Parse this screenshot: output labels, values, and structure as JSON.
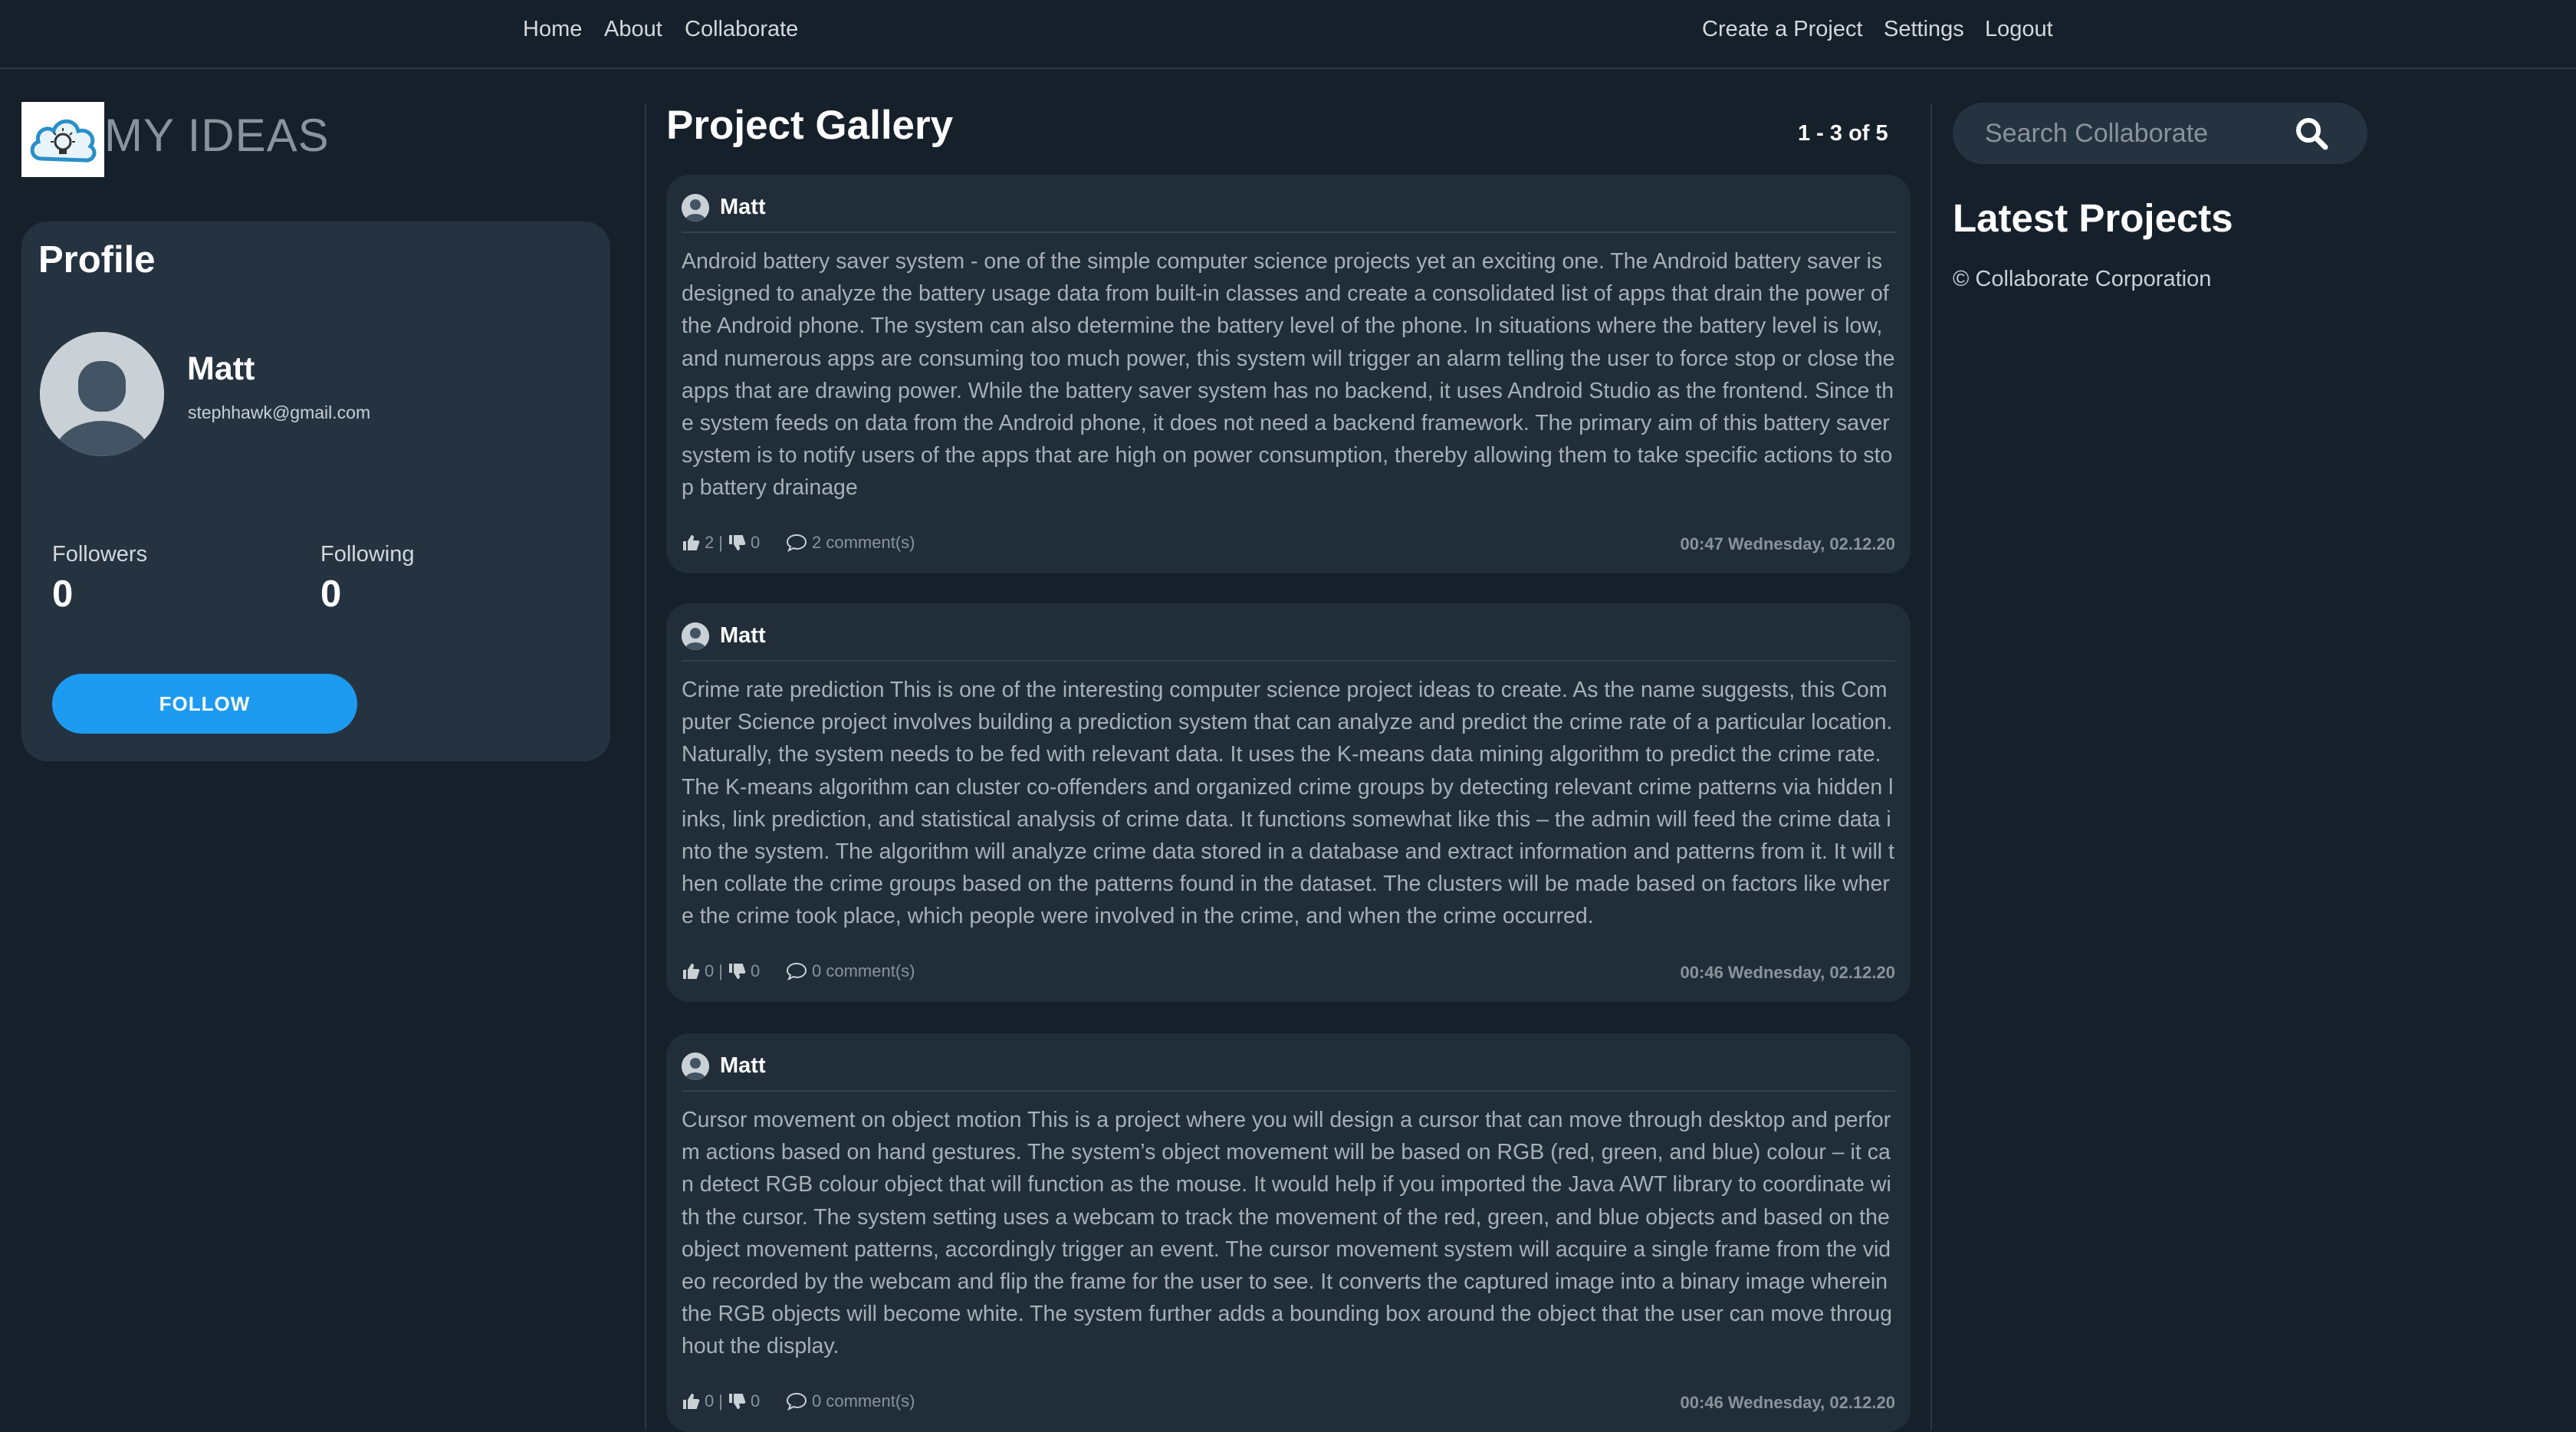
{
  "nav": {
    "left": [
      "Home",
      "About",
      "Collaborate"
    ],
    "right": [
      "Create a Project",
      "Settings",
      "Logout"
    ]
  },
  "brand": {
    "name": "MY IDEAS",
    "logo_icon": "cloud-lightbulb-icon"
  },
  "profile": {
    "title": "Profile",
    "name": "Matt",
    "email": "stephhawk@gmail.com",
    "followers_label": "Followers",
    "followers": "0",
    "following_label": "Following",
    "following": "0",
    "follow_button": "FOLLOW"
  },
  "gallery": {
    "title": "Project Gallery",
    "pager": "1 - 3 of 5",
    "posts": [
      {
        "author": "Matt",
        "body": "Android battery saver system - one of the simple computer science projects yet an exciting one. The Android battery saver is designed to analyze the battery usage data from built-in classes and create a consolidated list of apps that drain the power of the Android phone. The system can also determine the battery level of the phone. In situations where the battery level is low, and numerous apps are consuming too much power, this system will trigger an alarm telling the user to force stop or close the apps that are drawing power. While the battery saver system has no backend, it uses Android Studio as the frontend. Since the system feeds on data from the Android phone, it does not need a backend framework. The primary aim of this battery saver system is to notify users of the apps that are high on power consumption, thereby allowing them to take specific actions to stop battery drainage",
        "likes": "2",
        "dislikes": "0",
        "comments": "2 comment(s)",
        "timestamp": "00:47 Wednesday, 02.12.20"
      },
      {
        "author": "Matt",
        "body": "Crime rate prediction This is one of the interesting computer science project ideas to create. As the name suggests, this Computer Science project involves building a prediction system that can analyze and predict the crime rate of a particular location. Naturally, the system needs to be fed with relevant data. It uses the K-means data mining algorithm to predict the crime rate. The K-means algorithm can cluster co-offenders and organized crime groups by detecting relevant crime patterns via hidden links, link prediction, and statistical analysis of crime data. It functions somewhat like this – the admin will feed the crime data into the system. The algorithm will analyze crime data stored in a database and extract information and patterns from it. It will then collate the crime groups based on the patterns found in the dataset. The clusters will be made based on factors like where the crime took place, which people were involved in the crime, and when the crime occurred.",
        "likes": "0",
        "dislikes": "0",
        "comments": "0 comment(s)",
        "timestamp": "00:46 Wednesday, 02.12.20"
      },
      {
        "author": "Matt",
        "body": "Cursor movement on object motion This is a project where you will design a cursor that can move through desktop and perform actions based on hand gestures. The system’s object movement will be based on RGB (red, green, and blue) colour – it can detect RGB colour object that will function as the mouse. It would help if you imported the Java AWT library to coordinate with the cursor. The system setting uses a webcam to track the movement of the red, green, and blue objects and based on the object movement patterns, accordingly trigger an event. The cursor movement system will acquire a single frame from the video recorded by the webcam and flip the frame for the user to see. It converts the captured image into a binary image wherein the RGB objects will become white. The system further adds a bounding box around the object that the user can move throughout the display.",
        "likes": "0",
        "dislikes": "0",
        "comments": "0 comment(s)",
        "timestamp": "00:46 Wednesday, 02.12.20"
      }
    ]
  },
  "search": {
    "placeholder": "Search Collaborate"
  },
  "sidebar_right": {
    "latest_title": "Latest Projects",
    "copyright": "© Collaborate Corporation"
  },
  "colors": {
    "accent": "#1d9bf0",
    "background": "#15202b",
    "card": "#253341",
    "post_card": "#212d39"
  }
}
